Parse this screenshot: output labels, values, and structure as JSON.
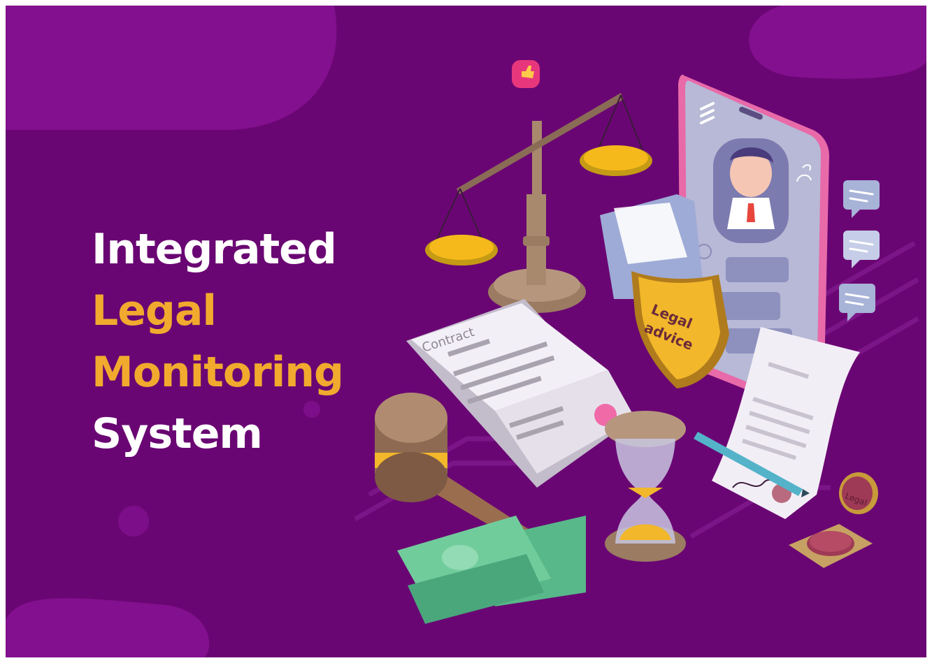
{
  "headline": {
    "line1": "Integrated",
    "line2": "Legal",
    "line3": "Monitoring",
    "line4": "System"
  },
  "illustration": {
    "contract_title": "Contract",
    "shield_line1": "Legal",
    "shield_line2": "advice",
    "stamp_text": "Legal"
  },
  "colors": {
    "background": "#6a0673",
    "blob": "#83108f",
    "headline_white": "#ffffff",
    "headline_gold": "#f1aa2e"
  }
}
